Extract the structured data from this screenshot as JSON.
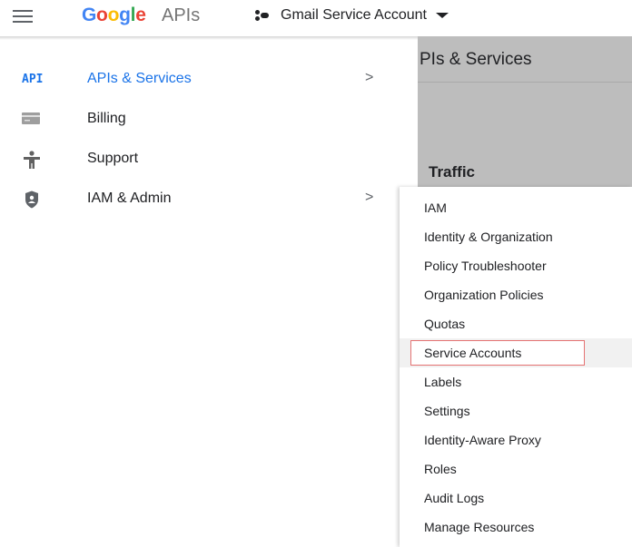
{
  "header": {
    "brand_google": "Google",
    "brand_apis": "APIs",
    "project": "Gmail Service Account"
  },
  "background": {
    "title": "PIs & Services",
    "section": "Traffic"
  },
  "sidebar": {
    "items": [
      {
        "label": "APIs & Services",
        "icon": "api-icon",
        "has_chevron": true,
        "active": true
      },
      {
        "label": "Billing",
        "icon": "billing-card-icon",
        "has_chevron": false
      },
      {
        "label": "Support",
        "icon": "support-person-icon",
        "has_chevron": false
      },
      {
        "label": "IAM & Admin",
        "icon": "shield-icon",
        "has_chevron": true
      }
    ],
    "chevron": ">"
  },
  "flyout": {
    "items": [
      "IAM",
      "Identity & Organization",
      "Policy Troubleshooter",
      "Organization Policies",
      "Quotas",
      "Service Accounts",
      "Labels",
      "Settings",
      "Identity-Aware Proxy",
      "Roles",
      "Audit Logs",
      "Manage Resources"
    ],
    "highlighted": "Service Accounts",
    "highlight_color": "#e57373"
  },
  "icons": {
    "api_text": "API"
  }
}
